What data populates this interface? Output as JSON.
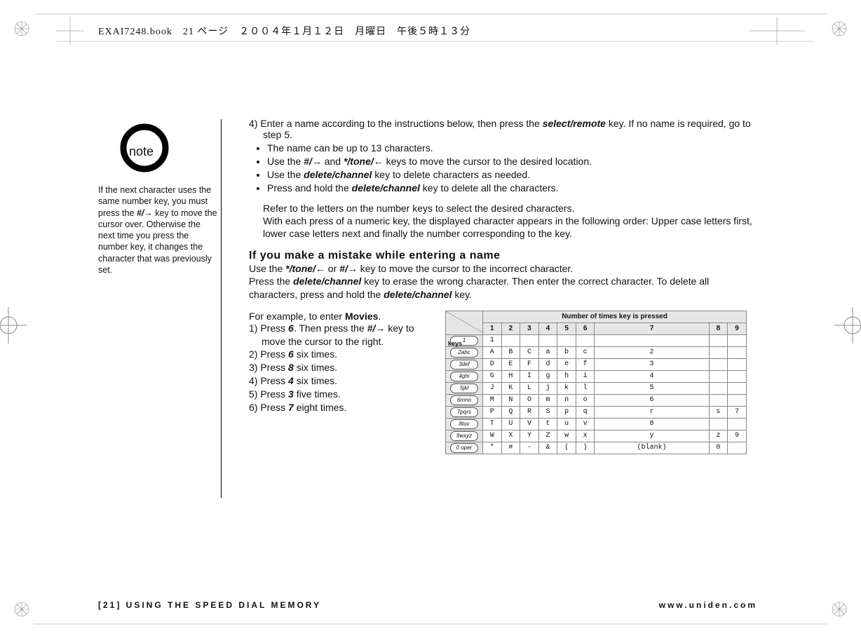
{
  "meta": {
    "top_line": "EXAI7248.book　21 ページ　２００４年１月１２日　月曜日　午後５時１３分"
  },
  "note": {
    "badge": "note",
    "text_parts": {
      "a": "If the next character uses the same number key, you must press the ",
      "key": "#/",
      "arrow": "→",
      "b": " key to move the cursor over. Otherwise the next time you press the number key, it changes the character that was previously set."
    }
  },
  "step4": {
    "lead_a": "4) Enter a name according to the instructions below, then press the ",
    "key_select_remote": "select/remote",
    "lead_b": " key. If no name is required, go to step 5.",
    "b1": "The name can be up to 13 characters.",
    "b2_a": "Use the ",
    "b2_key1": "#/",
    "b2_arr1": "→",
    "b2_mid": " and ",
    "b2_key2": "*/tone/",
    "b2_arr2": "←",
    "b2_b": " keys to move the cursor to the desired location.",
    "b3_a": "Use the ",
    "b3_key": "delete/channel",
    "b3_b": " key to delete characters as needed.",
    "b4_a": "Press and hold the ",
    "b4_key": "delete/channel",
    "b4_b": " key to delete all the characters."
  },
  "para": {
    "p1": "Refer to the letters on the number keys to select the desired characters.",
    "p2": "With each press of a numeric key, the displayed character appears in the following order: Upper case letters first, lower case letters next and finally the number corresponding to the key."
  },
  "mistake": {
    "head": "If you make a mistake while entering a name",
    "a": "Use the ",
    "k1": "*/tone/",
    "ar1": "←",
    "mid": " or ",
    "k2": "#/",
    "ar2": "→",
    "b": " key to move the cursor to the incorrect character.",
    "c": "Press the ",
    "k3": "delete/channel",
    "d": " key to erase the wrong character. Then enter the correct character. To delete all characters, press and hold the ",
    "k4": "delete/channel",
    "e": " key."
  },
  "example": {
    "lead_a": "For example, to enter ",
    "word": "Movies",
    "lead_b": ".",
    "s1a": "1) Press ",
    "s1k": "6",
    "s1b": ". Then press the ",
    "s1k2": "#/",
    "s1arr": "→",
    "s1c": " key to move the cursor to the right.",
    "s2a": "2) Press ",
    "s2k": "6",
    "s2b": " six times.",
    "s3a": "3) Press ",
    "s3k": "8",
    "s3b": " six times.",
    "s4a": "4) Press ",
    "s4k": "4",
    "s4b": " six times.",
    "s5a": "5) Press ",
    "s5k": "3",
    "s5b": " five times.",
    "s6a": "6) Press ",
    "s6k": "7",
    "s6b": " eight times."
  },
  "table": {
    "header_span": "Number of times key is pressed",
    "col_keys": "keys",
    "cols": [
      "1",
      "2",
      "3",
      "4",
      "5",
      "6",
      "7",
      "8",
      "9"
    ],
    "rows": [
      {
        "key": "1",
        "cells": [
          "1",
          "",
          "",
          "",
          "",
          "",
          "",
          "",
          ""
        ]
      },
      {
        "key": "2abc",
        "cells": [
          "A",
          "B",
          "C",
          "a",
          "b",
          "c",
          "2",
          "",
          ""
        ]
      },
      {
        "key": "3def",
        "cells": [
          "D",
          "E",
          "F",
          "d",
          "e",
          "f",
          "3",
          "",
          ""
        ]
      },
      {
        "key": "4ghi",
        "cells": [
          "G",
          "H",
          "I",
          "g",
          "h",
          "i",
          "4",
          "",
          ""
        ]
      },
      {
        "key": "5jkl",
        "cells": [
          "J",
          "K",
          "L",
          "j",
          "k",
          "l",
          "5",
          "",
          ""
        ]
      },
      {
        "key": "6mno",
        "cells": [
          "M",
          "N",
          "O",
          "m",
          "n",
          "o",
          "6",
          "",
          ""
        ]
      },
      {
        "key": "7pqrs",
        "cells": [
          "P",
          "Q",
          "R",
          "S",
          "p",
          "q",
          "r",
          "s",
          "7"
        ]
      },
      {
        "key": "8tuv",
        "cells": [
          "T",
          "U",
          "V",
          "t",
          "u",
          "v",
          "8",
          "",
          ""
        ]
      },
      {
        "key": "9wxyz",
        "cells": [
          "W",
          "X",
          "Y",
          "Z",
          "w",
          "x",
          "y",
          "z",
          "9"
        ]
      },
      {
        "key": "0 oper",
        "cells": [
          "*",
          "#",
          "-",
          "&",
          "(",
          ")",
          "(blank)",
          "0",
          ""
        ]
      }
    ]
  },
  "footer": {
    "left": "[21] USING THE SPEED DIAL MEMORY",
    "right": "www.uniden.com"
  }
}
